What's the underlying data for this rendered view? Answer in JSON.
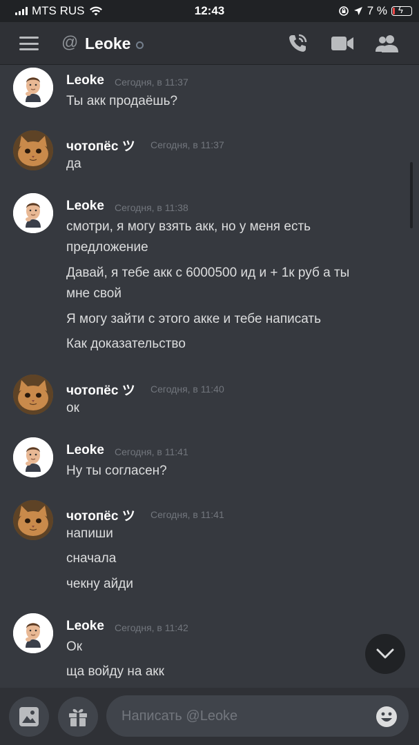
{
  "status_bar": {
    "carrier": "MTS RUS",
    "time": "12:43",
    "battery": "7 %"
  },
  "header": {
    "channel_prefix": "@",
    "channel_name": "Leoke"
  },
  "messages": [
    {
      "author": "Leoke",
      "timestamp": "Сегодня, в 11:37",
      "avatar": "man-avatar",
      "lines": [
        "Ты акк продаёшь?"
      ]
    },
    {
      "author": "чотопёс ツ",
      "timestamp": "Сегодня, в 11:37",
      "avatar": "cat-avatar",
      "lines": [
        "да"
      ]
    },
    {
      "author": "Leoke",
      "timestamp": "Сегодня, в 11:38",
      "avatar": "man-avatar",
      "lines": [
        "смотри, я могу взять акк, но у меня есть",
        "предложение",
        "Давай, я тебе акк с 6000500 ид и + 1к руб а ты",
        "мне свой",
        "Я могу зайти с этого акке и тебе написать",
        "Как доказательство"
      ]
    },
    {
      "author": "чотопёс ツ",
      "timestamp": "Сегодня, в 11:40",
      "avatar": "cat-avatar",
      "lines": [
        "ок"
      ]
    },
    {
      "author": "Leoke",
      "timestamp": "Сегодня, в 11:41",
      "avatar": "man-avatar",
      "lines": [
        "Ну ты согласен?"
      ]
    },
    {
      "author": "чотопёс ツ",
      "timestamp": "Сегодня, в 11:41",
      "avatar": "cat-avatar",
      "lines": [
        "напиши",
        "сначала",
        "чекну айди"
      ]
    },
    {
      "author": "Leoke",
      "timestamp": "Сегодня, в 11:42",
      "avatar": "man-avatar",
      "lines": [
        "Ок",
        "ща войду на акк"
      ]
    }
  ],
  "composer": {
    "placeholder": "Написать @Leoke"
  },
  "colors": {
    "background": "#36393f",
    "header": "#2f3136",
    "input": "#40444b",
    "battery_low": "#f04747"
  }
}
